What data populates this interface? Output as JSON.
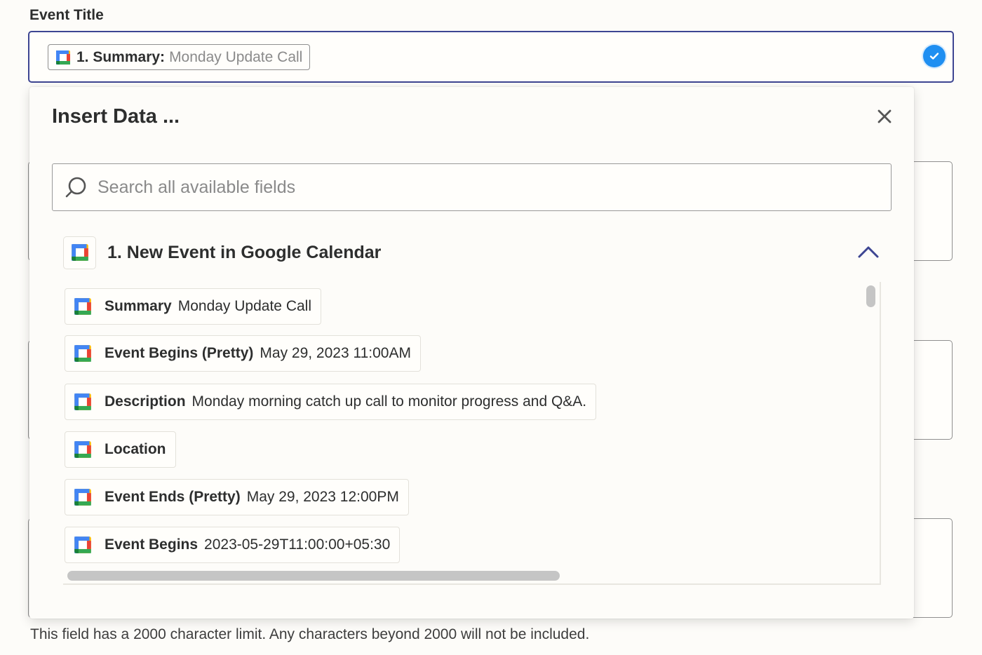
{
  "field": {
    "label": "Event Title",
    "chip_key": "1. Summary:",
    "chip_value": "Monday Update Call",
    "hint": "This field has a 2000 character limit. Any characters beyond 2000 will not be included."
  },
  "panel": {
    "title": "Insert Data ...",
    "search_placeholder": "Search all available fields",
    "group_title": "1. New Event in Google Calendar",
    "items": [
      {
        "key": "Summary",
        "value": "Monday Update Call"
      },
      {
        "key": "Event Begins (Pretty)",
        "value": "May 29, 2023 11:00AM"
      },
      {
        "key": "Description",
        "value": "Monday morning catch up call to monitor progress and Q&A."
      },
      {
        "key": "Location",
        "value": ""
      },
      {
        "key": "Event Ends (Pretty)",
        "value": "May 29, 2023 12:00PM"
      },
      {
        "key": "Event Begins",
        "value": "2023-05-29T11:00:00+05:30"
      }
    ]
  },
  "icons": {
    "app": "google-calendar-icon",
    "check": "check-circle-icon",
    "close": "close-icon",
    "search": "search-icon",
    "collapse": "chevron-up-icon"
  },
  "colors": {
    "focus_border": "#3d4592",
    "check": "#1f8ff1",
    "chevron": "#3d4592"
  }
}
